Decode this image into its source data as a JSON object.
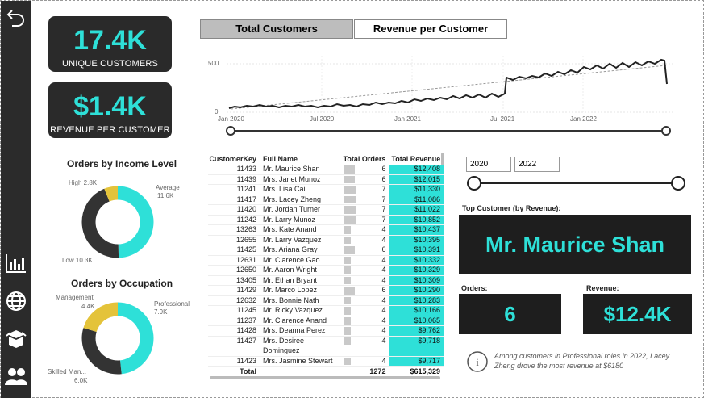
{
  "kpis": {
    "customers": {
      "value": "17.4K",
      "label": "UNIQUE CUSTOMERS"
    },
    "revenue": {
      "value": "$1.4K",
      "label": "REVENUE PER CUSTOMER"
    }
  },
  "tabs": {
    "total_customers": "Total Customers",
    "revenue_per_customer": "Revenue per Customer"
  },
  "line_chart": {
    "y_ticks": [
      "500",
      "0"
    ],
    "x_ticks": [
      "Jan 2020",
      "Jul 2020",
      "Jan 2021",
      "Jul 2021",
      "Jan 2022"
    ]
  },
  "income_chart": {
    "title": "Orders by Income Level",
    "labels": {
      "high": "High 2.8K",
      "average": "Average",
      "average_val": "11.6K",
      "low": "Low 10.3K"
    }
  },
  "occupation_chart": {
    "title": "Orders by Occupation",
    "labels": {
      "management": "Management",
      "management_val": "4.4K",
      "professional": "Professional",
      "professional_val": "7.9K",
      "skilled": "Skilled Man...",
      "skilled_val": "6.0K"
    }
  },
  "table": {
    "headers": [
      "CustomerKey",
      "Full Name",
      "Total Orders",
      "Total Revenue"
    ],
    "rows": [
      [
        "11433",
        "Mr. Maurice Shan",
        "6",
        "$12,408"
      ],
      [
        "11439",
        "Mrs. Janet Munoz",
        "6",
        "$12,015"
      ],
      [
        "11241",
        "Mrs. Lisa Cai",
        "7",
        "$11,330"
      ],
      [
        "11417",
        "Mrs. Lacey Zheng",
        "7",
        "$11,086"
      ],
      [
        "11420",
        "Mr. Jordan Turner",
        "7",
        "$11,022"
      ],
      [
        "11242",
        "Mr. Larry Munoz",
        "7",
        "$10,852"
      ],
      [
        "13263",
        "Mrs. Kate Anand",
        "4",
        "$10,437"
      ],
      [
        "12655",
        "Mr. Larry Vazquez",
        "4",
        "$10,395"
      ],
      [
        "11425",
        "Mrs. Ariana Gray",
        "6",
        "$10,391"
      ],
      [
        "12631",
        "Mr. Clarence Gao",
        "4",
        "$10,332"
      ],
      [
        "12650",
        "Mr. Aaron Wright",
        "4",
        "$10,329"
      ],
      [
        "13405",
        "Mr. Ethan Bryant",
        "4",
        "$10,309"
      ],
      [
        "11429",
        "Mr. Marco Lopez",
        "6",
        "$10,290"
      ],
      [
        "12632",
        "Mrs. Bonnie Nath",
        "4",
        "$10,283"
      ],
      [
        "11245",
        "Mr. Ricky Vazquez",
        "4",
        "$10,166"
      ],
      [
        "11237",
        "Mr. Clarence Anand",
        "4",
        "$10,065"
      ],
      [
        "11428",
        "Mrs. Deanna Perez",
        "4",
        "$9,762"
      ],
      [
        "11427",
        "Mrs. Desiree",
        "4",
        "$9,718"
      ],
      [
        "",
        "Dominguez",
        "",
        ""
      ],
      [
        "11423",
        "Mrs. Jasmine Stewart",
        "4",
        "$9,717"
      ]
    ],
    "total": {
      "label": "Total",
      "orders": "1272",
      "revenue": "$615,329"
    }
  },
  "date_range": {
    "start": "2020",
    "end": "2022"
  },
  "top_customer": {
    "label": "Top Customer (by Revenue):",
    "name": "Mr. Maurice Shan"
  },
  "orders": {
    "label": "Orders:",
    "value": "6"
  },
  "revenue": {
    "label": "Revenue:",
    "value": "$12.4K"
  },
  "insight": {
    "text": "Among customers in Professional roles in 2022, Lacey Zheng drove the most revenue at $6180"
  },
  "colors": {
    "accent": "#2ee0d8",
    "dark": "#1e1e1e",
    "gold": "#e4c33a",
    "charcoal": "#333333"
  }
}
